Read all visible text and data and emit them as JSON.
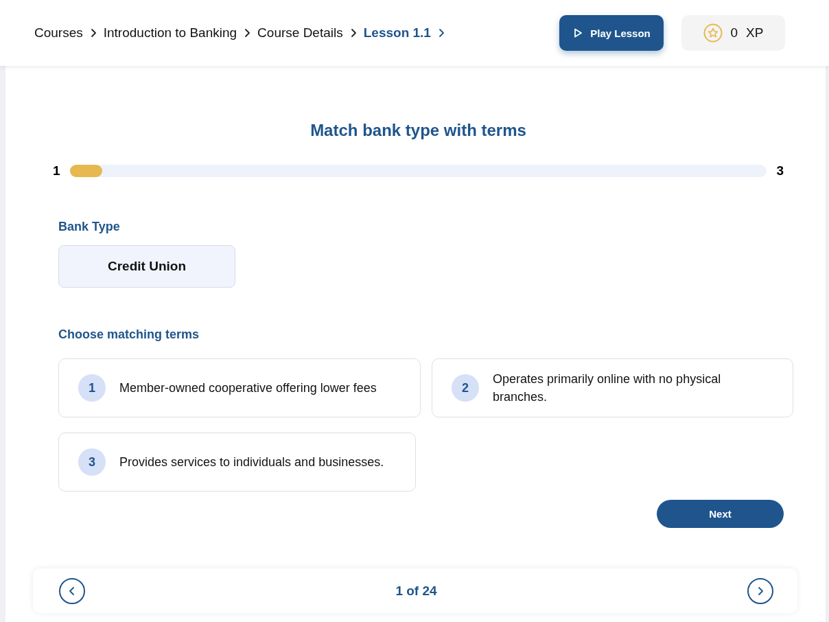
{
  "breadcrumb": [
    {
      "label": "Courses",
      "selected": false
    },
    {
      "label": "Introduction to Banking",
      "selected": false
    },
    {
      "label": "Course Details",
      "selected": false
    },
    {
      "label": "Lesson 1.1",
      "selected": true
    }
  ],
  "play_button": {
    "label": "Play Lesson"
  },
  "xp": {
    "value": "0",
    "unit": "XP"
  },
  "title": "Match bank type with terms",
  "progress": {
    "start": "1",
    "end": "3",
    "level": 0.047
  },
  "bank_type": {
    "label": "Bank Type",
    "value": "Credit Union"
  },
  "terms": {
    "label": "Choose matching terms",
    "options": [
      {
        "number": "1",
        "text": "Member-owned cooperative offering lower fees"
      },
      {
        "number": "2",
        "text": "Operates primarily online with no physical branches."
      },
      {
        "number": "3",
        "text": "Provides services to individuals and businesses."
      }
    ]
  },
  "next_button": {
    "label": "Next"
  },
  "pager": {
    "label": "1 of 24"
  }
}
